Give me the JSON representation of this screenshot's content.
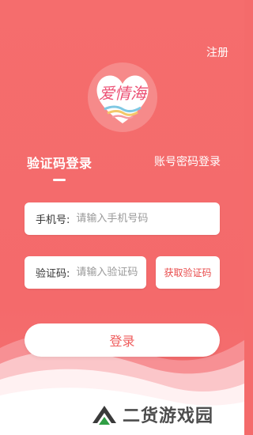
{
  "header": {
    "register_label": "注册"
  },
  "logo": {
    "text": "爱情海"
  },
  "tabs": [
    {
      "label": "验证码登录",
      "active": true
    },
    {
      "label": "账号密码登录",
      "active": false
    }
  ],
  "form": {
    "phone": {
      "label": "手机号:",
      "placeholder": "请输入手机号码",
      "value": ""
    },
    "code": {
      "label": "验证码:",
      "placeholder": "请输入验证码",
      "value": ""
    },
    "get_code_label": "获取验证码",
    "login_label": "登录"
  },
  "watermark": {
    "text": "二货游戏园"
  },
  "colors": {
    "background": "#f46b6b",
    "accent_text": "#ef5d5d",
    "card": "#ffffff"
  }
}
